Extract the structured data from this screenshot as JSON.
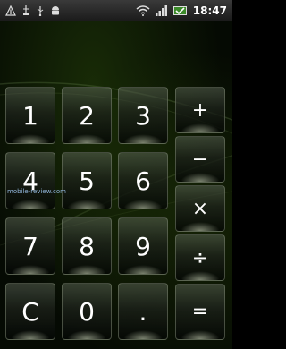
{
  "status_bar": {
    "time": "18:47",
    "icons": [
      "warning-icon",
      "usb-icon",
      "usb-debug-icon",
      "android-icon",
      "wifi-icon",
      "signal-icon",
      "battery-icon"
    ]
  },
  "keypad": {
    "digits": {
      "k1": "1",
      "k2": "2",
      "k3": "3",
      "k4": "4",
      "k5": "5",
      "k6": "6",
      "k7": "7",
      "k8": "8",
      "k9": "9",
      "k0": "0"
    },
    "clear_label": "C",
    "decimal_label": ".",
    "operators": {
      "add": "+",
      "subtract": "−",
      "multiply": "×",
      "divide": "÷",
      "equals": "="
    }
  },
  "watermark": "mobile-review.com"
}
